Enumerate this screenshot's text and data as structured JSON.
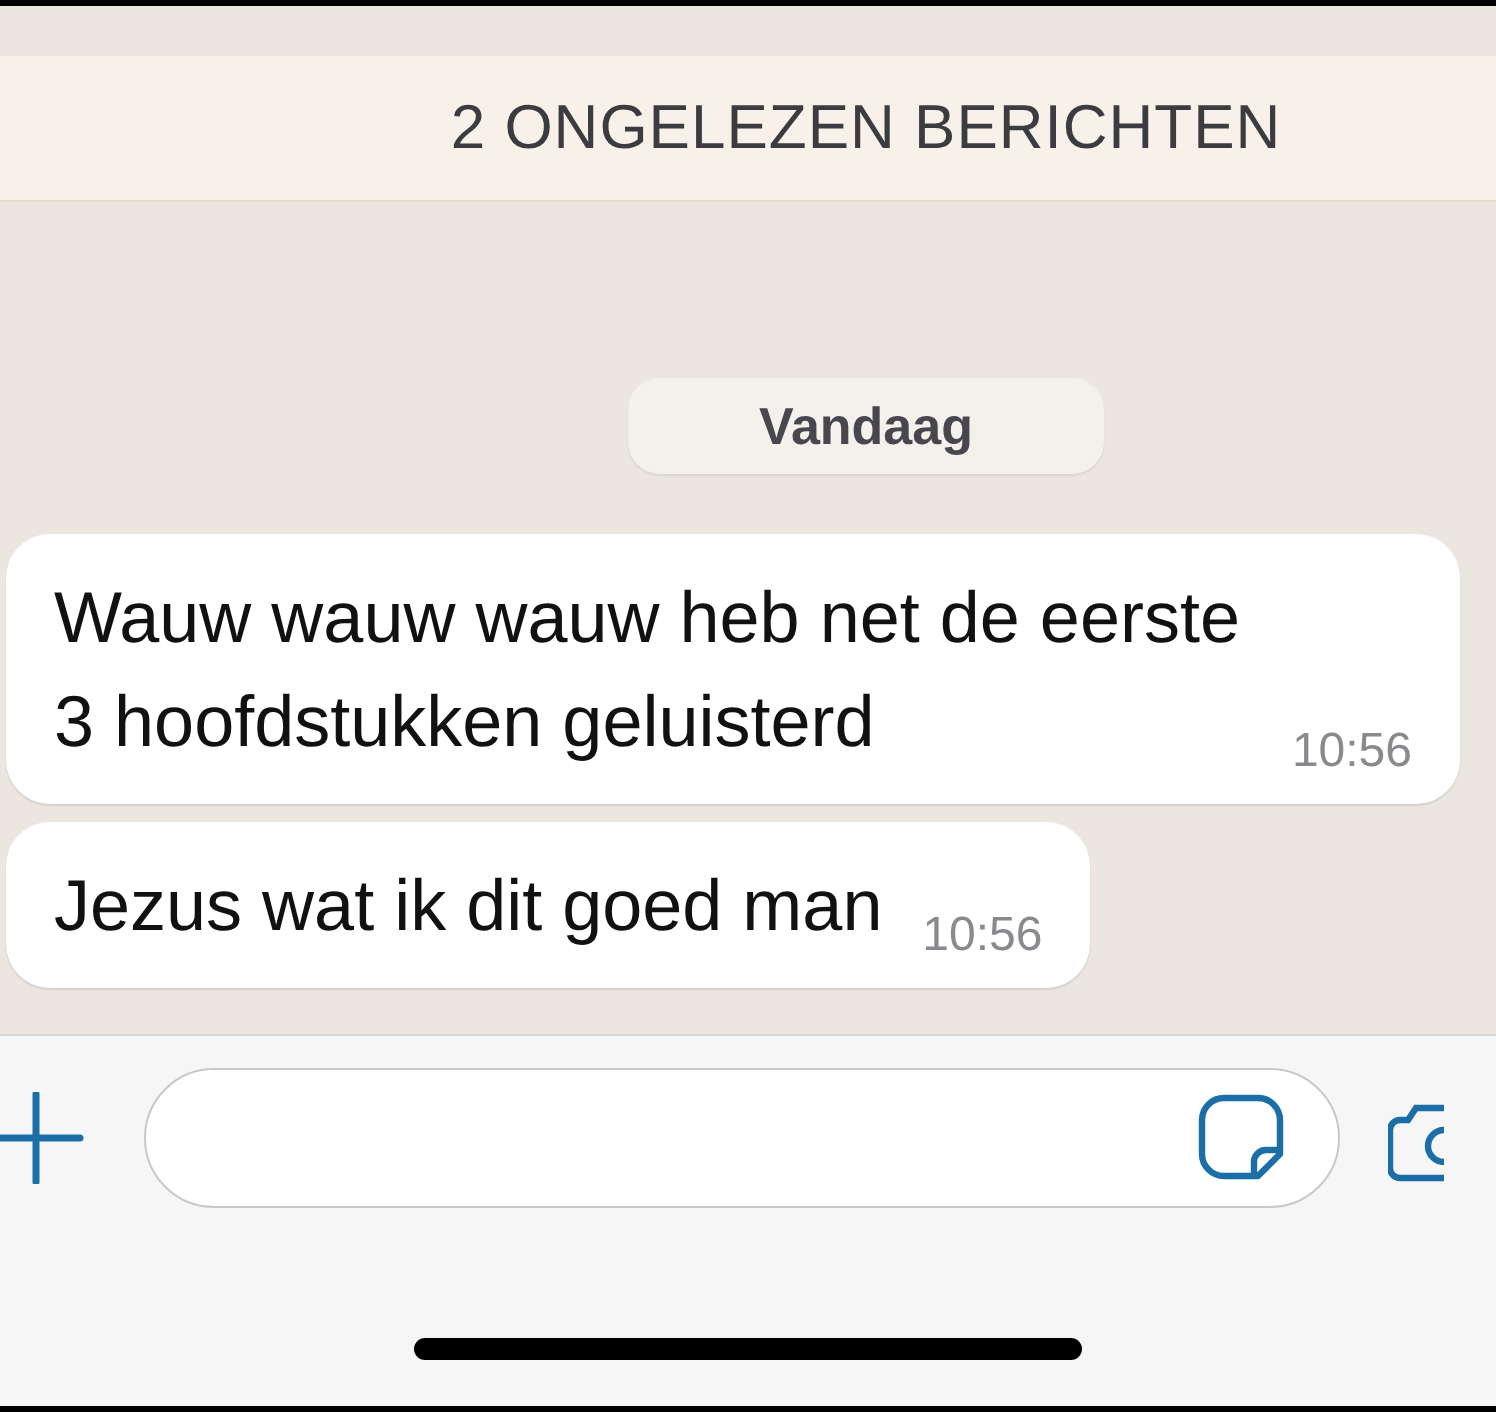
{
  "unread_banner": "2 ONGELEZEN BERICHTEN",
  "date_separator": "Vandaag",
  "messages": [
    {
      "text": "Wauw wauw wauw heb net de eerste 3 hoofdstukken geluisterd",
      "time": "10:56"
    },
    {
      "text": "Jezus wat ik dit goed man",
      "time": "10:56"
    }
  ]
}
